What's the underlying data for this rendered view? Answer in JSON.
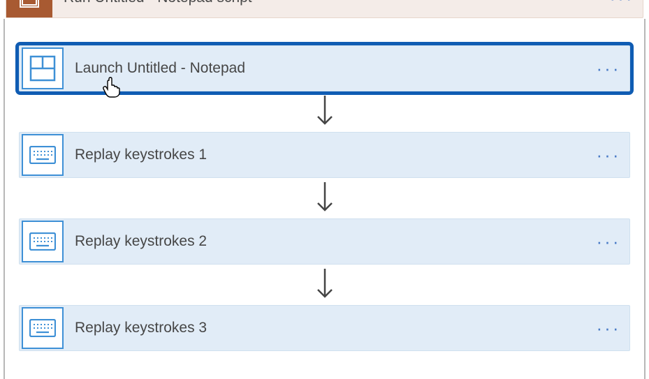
{
  "header": {
    "title": "Run Untitled - Notepad script",
    "icon": "script-icon",
    "menu_dots": "···"
  },
  "steps": [
    {
      "label": "Launch Untitled - Notepad",
      "icon": "window-icon",
      "selected": true,
      "menu_dots": "···"
    },
    {
      "label": "Replay keystrokes 1",
      "icon": "keyboard-icon",
      "selected": false,
      "menu_dots": "···"
    },
    {
      "label": "Replay keystrokes 2",
      "icon": "keyboard-icon",
      "selected": false,
      "menu_dots": "···"
    },
    {
      "label": "Replay keystrokes 3",
      "icon": "keyboard-icon",
      "selected": false,
      "menu_dots": "···"
    }
  ],
  "colors": {
    "header_icon_bg": "#a85a32",
    "step_bg": "#e1ecf7",
    "selection": "#0f5cb3",
    "accent": "#3e90d6"
  }
}
